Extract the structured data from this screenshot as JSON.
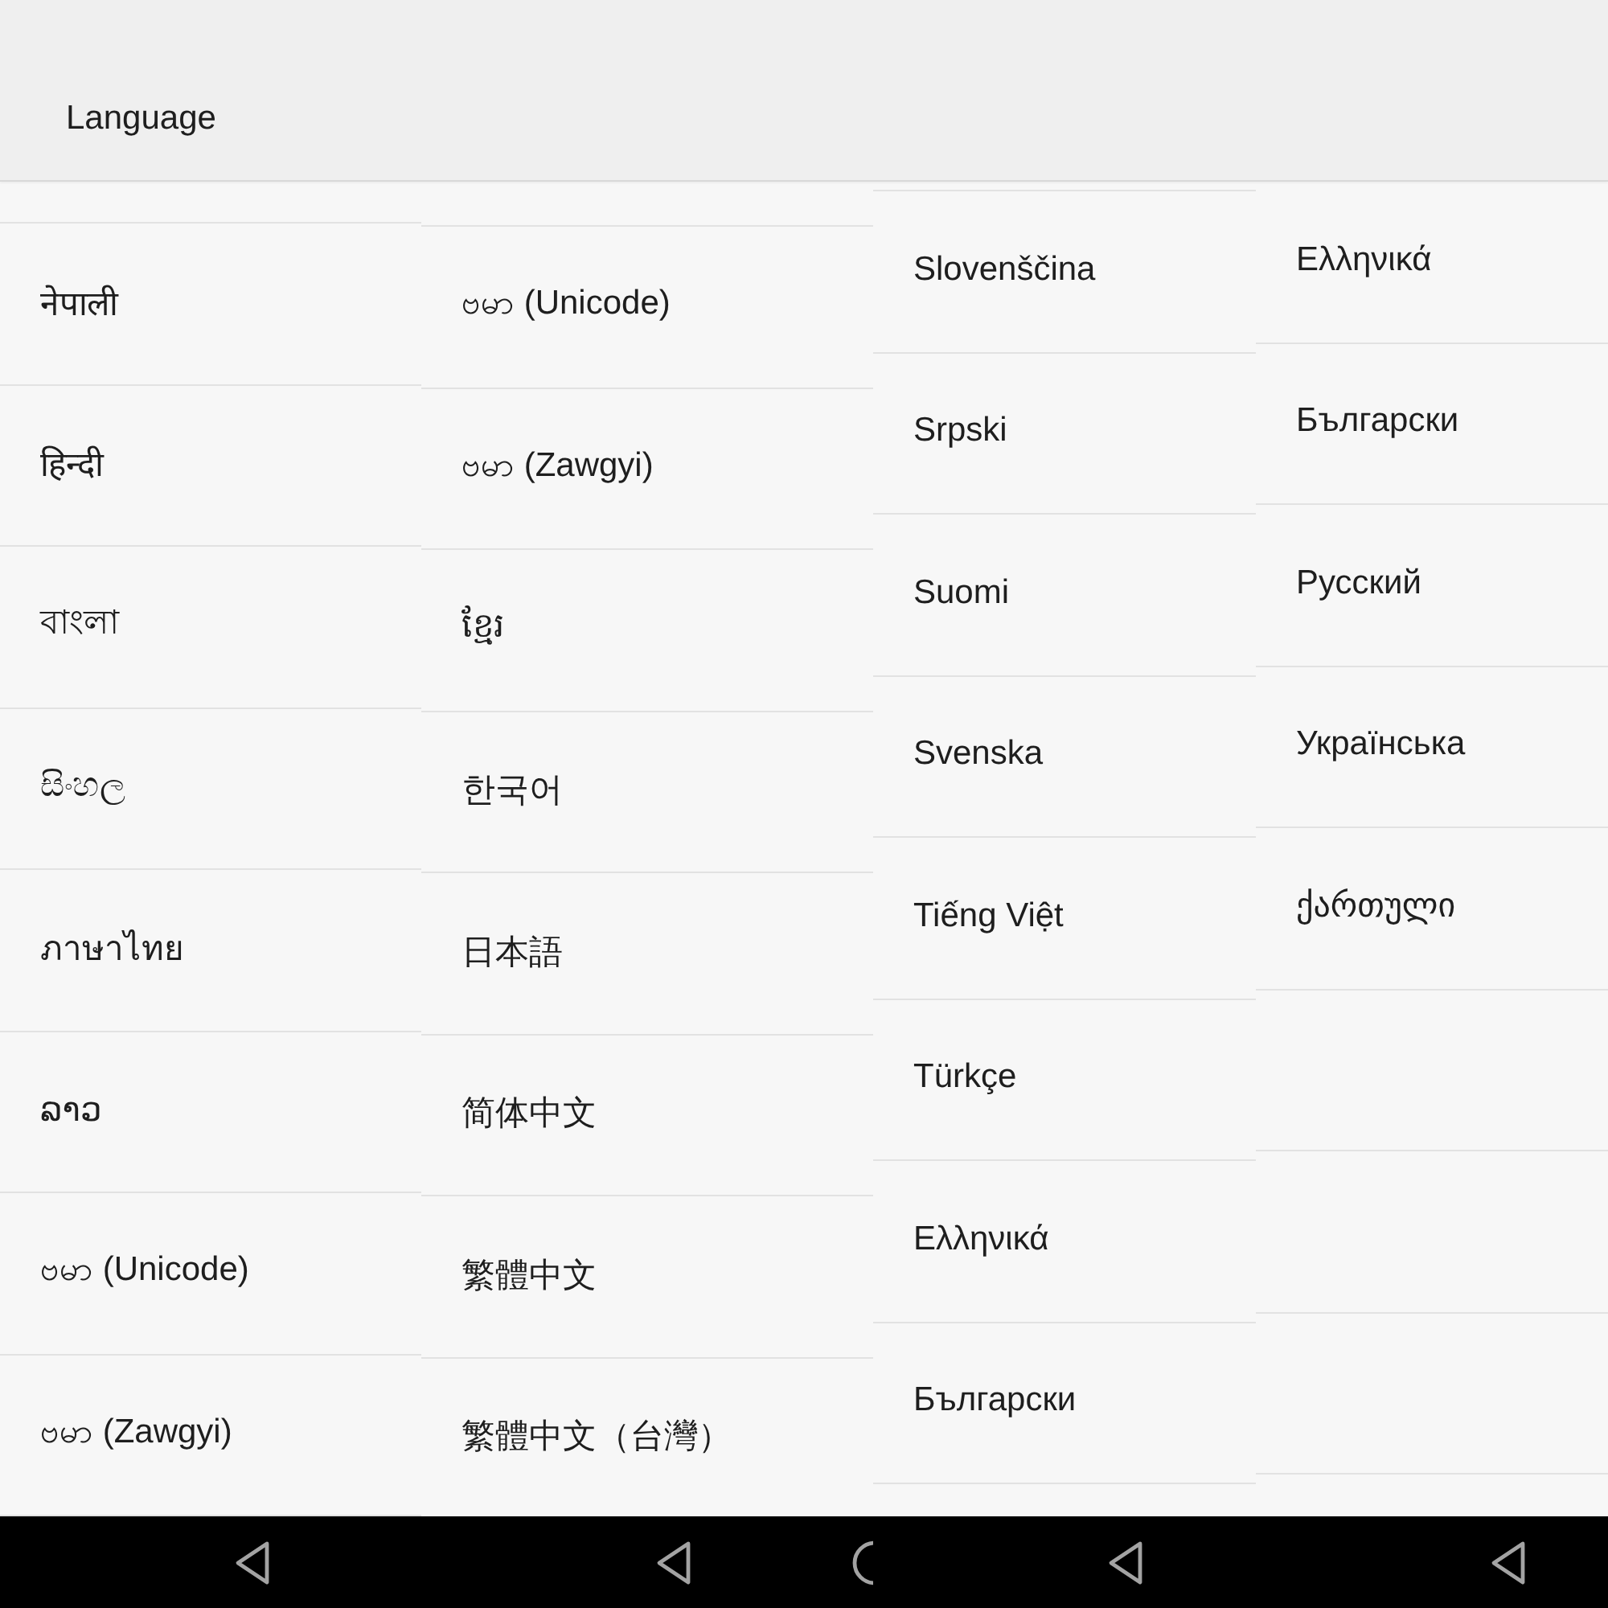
{
  "header": {
    "title": "Language"
  },
  "columns": [
    {
      "items": [
        "नेपाली",
        "हिन्दी",
        "বাংলা",
        "සිංහල",
        "ภาษาไทย",
        "ລາວ",
        "ဗမာ (Unicode)",
        "ဗမာ (Zawgyi)"
      ]
    },
    {
      "items": [
        "ဗမာ (Unicode)",
        "ဗမာ (Zawgyi)",
        "ខ្មែរ",
        "한국어",
        "日本語",
        "简体中文",
        "繁體中文",
        "繁體中文（台灣）"
      ]
    },
    {
      "items": [
        "Slovenščina",
        "Srpski",
        "Suomi",
        "Svenska",
        "Tiếng Việt",
        "Türkçe",
        "Ελληνικά",
        "Български"
      ]
    },
    {
      "items": [
        "Ελληνικά",
        "Български",
        "Русский",
        "Українська",
        "ქართული"
      ]
    }
  ],
  "nav_bar": [
    {
      "buttons": [
        {
          "kind": "back"
        }
      ]
    },
    {
      "buttons": [
        {
          "kind": "back"
        },
        {
          "kind": "home"
        }
      ]
    },
    {
      "buttons": [
        {
          "kind": "back"
        }
      ]
    },
    {
      "buttons": [
        {
          "kind": "back"
        }
      ]
    }
  ]
}
